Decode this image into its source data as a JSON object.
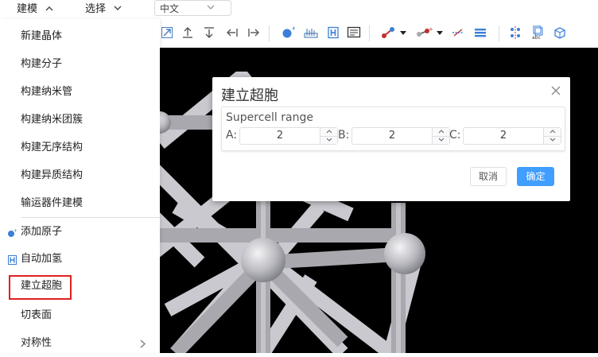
{
  "menubar": {
    "items": [
      {
        "label": "建模",
        "icon": "chevron-up-icon"
      },
      {
        "label": "选择",
        "icon": "chevron-down-icon"
      }
    ],
    "language_select": {
      "value": "中文",
      "icon": "chevron-down-icon"
    }
  },
  "toolbar": {
    "icons": [
      "arrow-up-right-icon",
      "arrow-up-bar-icon",
      "arrow-down-bar-icon",
      "arrow-left-bar-icon",
      "arrow-right-bar-icon",
      "add-atom-icon",
      "ruler-icon",
      "hydrogen-icon",
      "panel-icon",
      "bond-dropdown-icon",
      "atom-dropdown-icon",
      "cut-line-icon",
      "layers-icon",
      "symmetry-grid-icon",
      "abc-cell-icon",
      "cube-tools-icon"
    ]
  },
  "dropdown": {
    "items": [
      {
        "label": "新建晶体"
      },
      {
        "label": "构建分子"
      },
      {
        "label": "构建纳米管"
      },
      {
        "label": "构建纳米团簇"
      },
      {
        "label": "构建无序结构"
      },
      {
        "label": "构建异质结构"
      },
      {
        "label": "输运器件建模"
      },
      {
        "label": "添加原子",
        "icon": "add-atom-icon"
      },
      {
        "label": "自动加氢",
        "icon": "hydrogen-icon"
      },
      {
        "label": "建立超胞"
      },
      {
        "label": "切表面"
      },
      {
        "label": "对称性",
        "icon": "chevron-right-icon"
      }
    ]
  },
  "dialog": {
    "title": "建立超胞",
    "group_title": "Supercell range",
    "fields": [
      {
        "label": "A:",
        "value": "2"
      },
      {
        "label": "B:",
        "value": "2"
      },
      {
        "label": "C:",
        "value": "2"
      }
    ],
    "cancel_label": "取消",
    "ok_label": "确定",
    "close_icon": "close-icon"
  },
  "colors": {
    "accent": "#409eff",
    "highlight": "#e02020",
    "viewport_bg": "#000000",
    "atom": "#c8c8cc"
  }
}
